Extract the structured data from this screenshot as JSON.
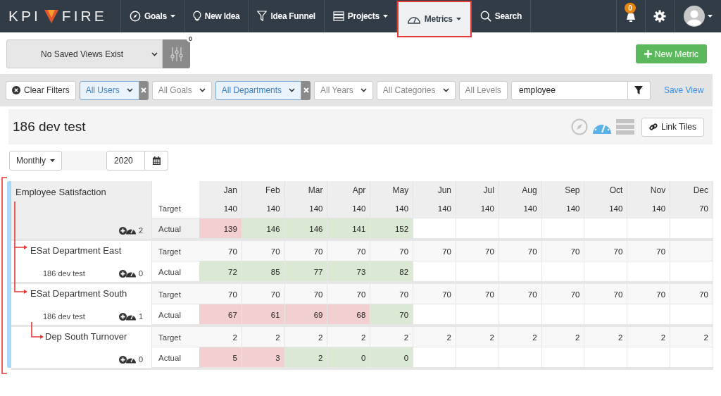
{
  "nav": {
    "logo_left": "KPI",
    "logo_right": "FIRE",
    "items": [
      {
        "kind": "compass",
        "label": "Goals",
        "caret": true,
        "selected": false
      },
      {
        "kind": "bulb",
        "label": "New Idea",
        "caret": false,
        "selected": false
      },
      {
        "kind": "funnel",
        "label": "Idea Funnel",
        "caret": false,
        "selected": false
      },
      {
        "kind": "projects",
        "label": "Projects",
        "caret": true,
        "selected": false
      },
      {
        "kind": "gauge",
        "label": "Metrics",
        "caret": true,
        "selected": true
      },
      {
        "kind": "search",
        "label": "Search",
        "caret": false,
        "selected": false
      }
    ],
    "notifications": "0"
  },
  "views": {
    "saved_view": "No Saved Views Exist",
    "filter_count": "0",
    "new_button": "New Metric"
  },
  "filters": [
    {
      "kind": "clear",
      "label": "Clear Filters"
    },
    {
      "kind": "select",
      "label": "All Users",
      "active": true
    },
    {
      "kind": "select",
      "label": "All Goals",
      "active": false
    },
    {
      "kind": "select",
      "label": "All Departments",
      "active": true
    },
    {
      "kind": "select",
      "label": "All Years",
      "active": false
    },
    {
      "kind": "select",
      "label": "All Categories",
      "active": false
    },
    {
      "kind": "plain",
      "label": "All Levels",
      "active": false
    },
    {
      "kind": "search",
      "value": "employee"
    },
    {
      "kind": "link",
      "label": "Save View"
    }
  ],
  "board": {
    "title": "186 dev test",
    "view_icons": [
      {
        "kind": "compass",
        "selected": false
      },
      {
        "kind": "gauge",
        "selected": true
      },
      {
        "kind": "list",
        "selected": false
      }
    ],
    "link_button": "Link Tiles"
  },
  "period": {
    "frequency": "Monthly",
    "year": "2020"
  },
  "table": {
    "months": [
      "Jan",
      "Feb",
      "Mar",
      "Apr",
      "May",
      "Jun",
      "Jul",
      "Aug",
      "Sep",
      "Oct",
      "Nov",
      "Dec"
    ],
    "metrics": [
      {
        "name": "Employee Satisfaction",
        "count": "2",
        "target_label": "Target",
        "actual_label": "Actual",
        "targets": [
          "140",
          "140",
          "140",
          "140",
          "140",
          "140",
          "140",
          "140",
          "140",
          "140",
          "140",
          "70"
        ],
        "actuals": [
          {
            "value": "139",
            "met": false
          },
          {
            "value": "146",
            "met": true
          },
          {
            "value": "146",
            "met": true
          },
          {
            "value": "141",
            "met": true
          },
          {
            "value": "152",
            "met": true
          }
        ],
        "children": [
          {
            "name": "ESat Department East",
            "owner": "186 dev test",
            "count": "0",
            "target_label": "Target",
            "actual_label": "Actual",
            "targets": [
              "70",
              "70",
              "70",
              "70",
              "70",
              "70",
              "70",
              "70",
              "70",
              "70",
              "70"
            ],
            "actuals": [
              {
                "value": "72",
                "met": true
              },
              {
                "value": "85",
                "met": true
              },
              {
                "value": "77",
                "met": true
              },
              {
                "value": "73",
                "met": true
              },
              {
                "value": "82",
                "met": true
              }
            ]
          },
          {
            "name": "ESat Department South",
            "owner": "186 dev test",
            "count": "1",
            "target_label": "Target",
            "actual_label": "Actual",
            "targets": [
              "70",
              "70",
              "70",
              "70",
              "70",
              "70",
              "70",
              "70",
              "70",
              "70",
              "70",
              "70"
            ],
            "actuals": [
              {
                "value": "67",
                "met": false
              },
              {
                "value": "61",
                "met": false
              },
              {
                "value": "69",
                "met": false
              },
              {
                "value": "68",
                "met": false
              },
              {
                "value": "70",
                "met": true
              }
            ],
            "children": [
              {
                "name": "Dep South Turnover",
                "count": "0",
                "target_label": "Target",
                "actual_label": "Actual",
                "targets": [
                  "2",
                  "2",
                  "2",
                  "2",
                  "2",
                  "2",
                  "2",
                  "2",
                  "2",
                  "2",
                  "2",
                  "2"
                ],
                "actuals": [
                  {
                    "value": "5",
                    "met": false
                  },
                  {
                    "value": "3",
                    "met": false
                  },
                  {
                    "value": "2",
                    "met": true
                  },
                  {
                    "value": "0",
                    "met": true
                  },
                  {
                    "value": "0",
                    "met": true
                  }
                ]
              }
            ]
          }
        ]
      }
    ]
  }
}
